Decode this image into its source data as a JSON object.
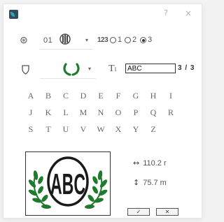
{
  "window": {
    "help_label": "?",
    "close_label": "×"
  },
  "font_row": {
    "font_icon": "monogram-font-icon",
    "font_value": "01",
    "dropdown_arrow": "▾",
    "lines_icon_label": "123",
    "radio_options": [
      {
        "label": "1",
        "selected": false
      },
      {
        "label": "2",
        "selected": false
      },
      {
        "label": "3",
        "selected": true
      }
    ]
  },
  "frame_row": {
    "shape_icon": "frame-shape-icon",
    "dropdown_arrow": "▾",
    "text_icon_label": "T",
    "text_value": "ABC",
    "char_count": "3 / 3"
  },
  "letters": [
    "A",
    "B",
    "C",
    "D",
    "E",
    "F",
    "G",
    "H",
    "I",
    "J",
    "K",
    "L",
    "M",
    "N",
    "O",
    "P",
    "Q",
    "R",
    "S",
    "T",
    "U",
    "V",
    "W",
    "X",
    "Y",
    "Z"
  ],
  "preview": {
    "monogram_text": "ABC",
    "wreath_color": "#1f7a2e"
  },
  "dimensions": {
    "width_icon": "↔",
    "width_value": "110.2 r",
    "height_icon": "↕",
    "height_value": "75.7 m"
  },
  "buttons": {
    "ok_label": "✓",
    "cancel_label": "✕"
  },
  "colors": {
    "accent": "#1f7a2e",
    "app_icon": "#2f4f5f"
  }
}
